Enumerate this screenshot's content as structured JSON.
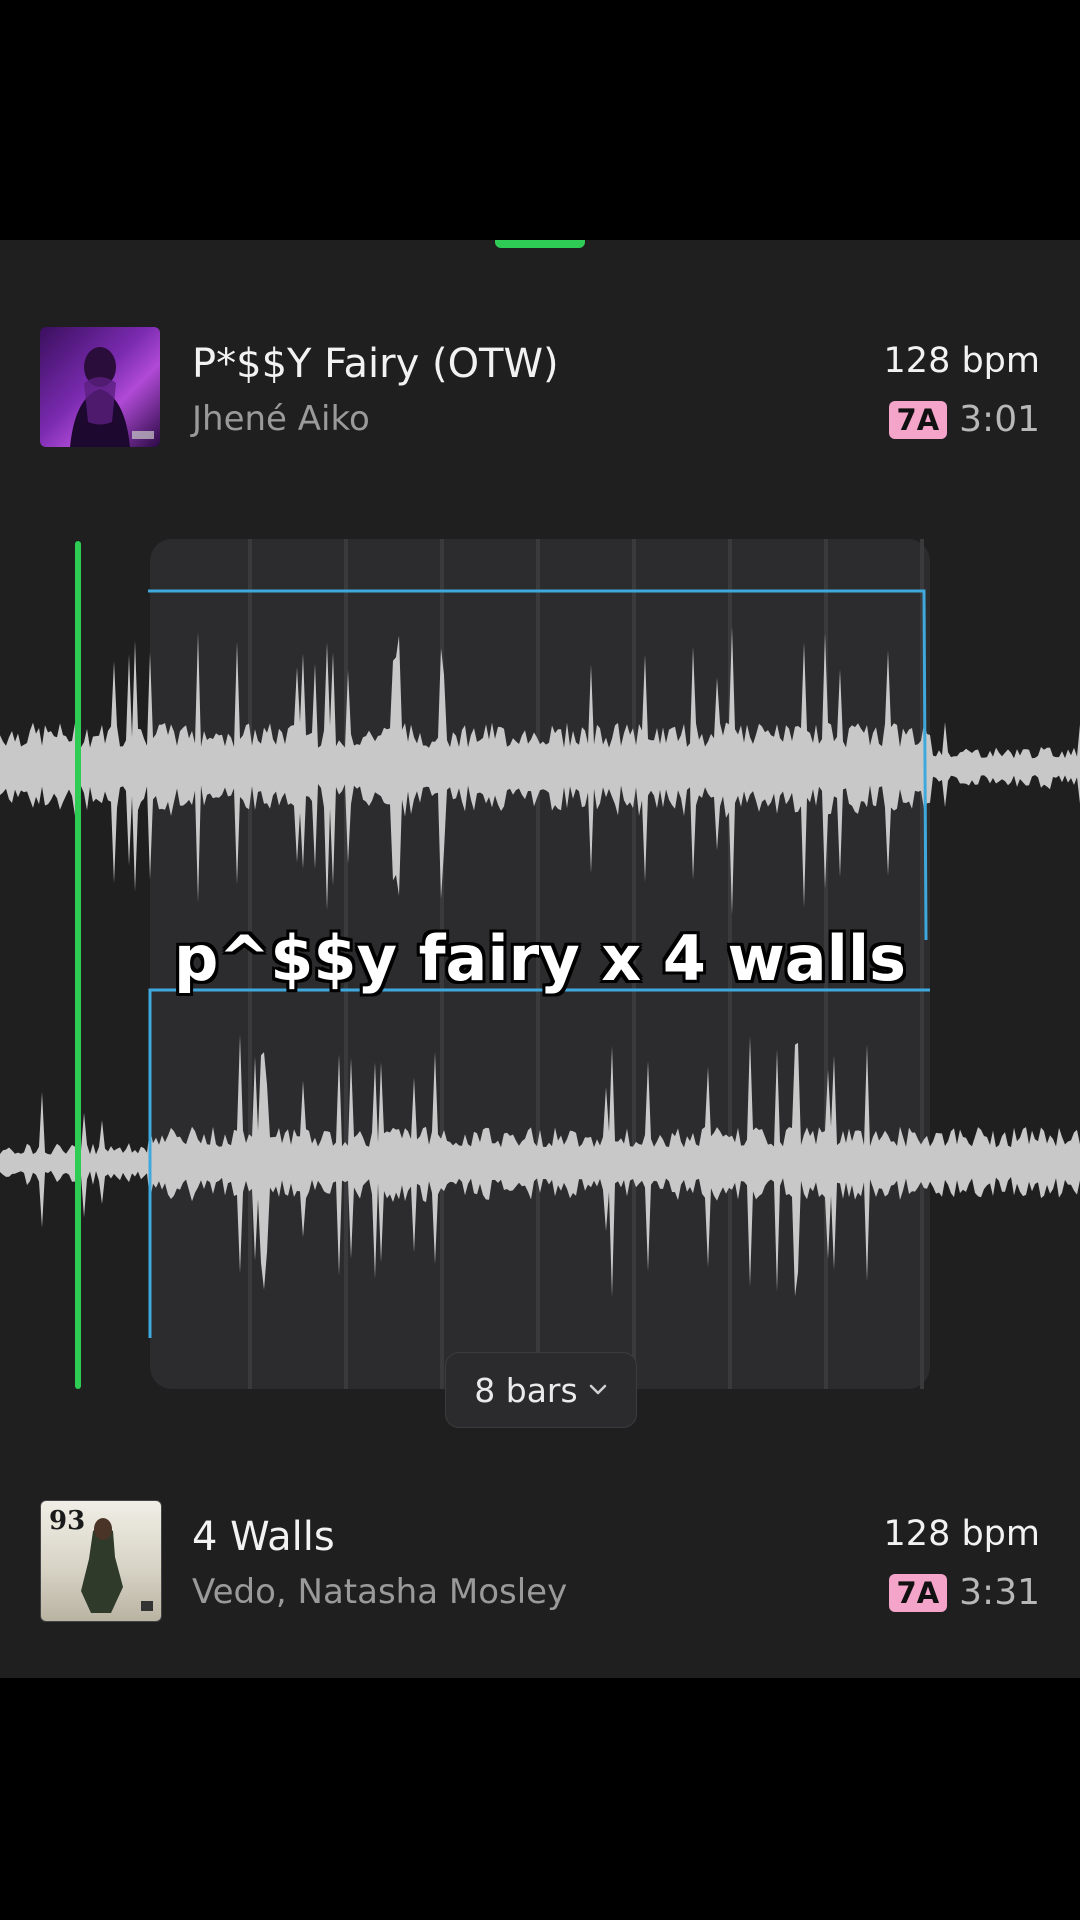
{
  "tracks": [
    {
      "title": "P*$$Y Fairy (OTW)",
      "artist": "Jhené Aiko",
      "bpm": "128 bpm",
      "key": "7A",
      "duration": "3:01"
    },
    {
      "title": "4 Walls",
      "artist": "Vedo, Natasha Mosley",
      "bpm": "128 bpm",
      "key": "7A",
      "duration": "3:31"
    }
  ],
  "transition": {
    "length_label": "8 bars"
  },
  "caption": "p^$$y fairy x 4 walls",
  "colors": {
    "playhead": "#2ecc55",
    "region_outline": "#3fa9dd",
    "key_badge": "#f4a3c9",
    "waveform": "#c8c8c8"
  },
  "icons": {
    "length_dropdown": "chevron-down-icon"
  }
}
